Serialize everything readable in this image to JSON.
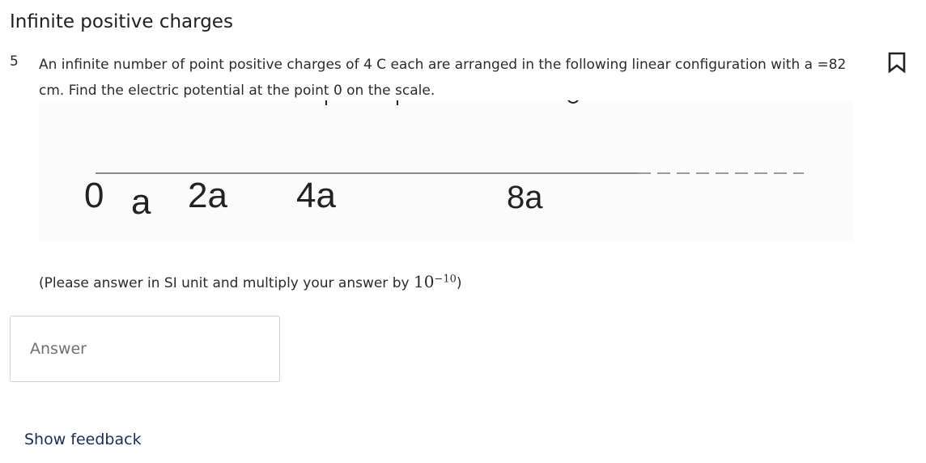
{
  "title": "Infinite positive charges",
  "question": {
    "number": "5",
    "text": "An infinite number of point positive charges of 4 C each are arranged in the following linear configuration with a =82 cm. Find the electric potential at the point 0 on the scale.",
    "figure_labels": [
      "0",
      "a",
      "2a",
      "4a",
      "8a"
    ],
    "note_prefix": "(Please answer in SI unit and multiply your answer by ",
    "note_base": "10",
    "note_exponent": "−10",
    "note_suffix": ")"
  },
  "answer": {
    "placeholder": "Answer",
    "value": ""
  },
  "feedback_label": "Show feedback",
  "icons": {
    "bookmark": "bookmark-icon"
  },
  "colors": {
    "text": "#2b2b2b",
    "link": "#1c2a5c",
    "border": "#cfcfcf"
  }
}
